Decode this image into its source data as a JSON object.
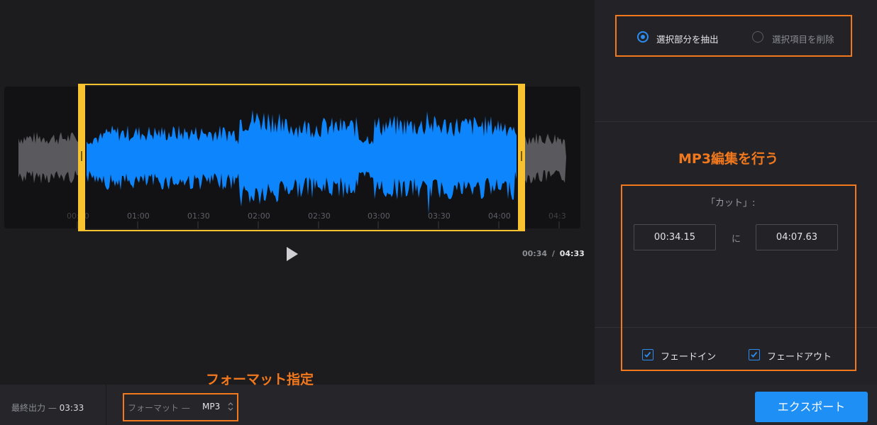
{
  "waveform": {
    "ticks": [
      "00:00",
      "01:00",
      "01:30",
      "02:00",
      "02:30",
      "03:00",
      "03:30",
      "04:00",
      "04:3"
    ]
  },
  "playback": {
    "current": "00:34",
    "separator": "/",
    "total": "04:33"
  },
  "mode": {
    "options": [
      {
        "label": "選択部分を抽出",
        "selected": true
      },
      {
        "label": "選択項目を削除",
        "selected": false
      }
    ]
  },
  "annotations": {
    "edit_heading": "MP3編集を行う",
    "format_heading": "フォーマット指定"
  },
  "cut": {
    "title": "「カット」:",
    "start": "00:34.15",
    "connector": "に",
    "end": "04:07.63"
  },
  "fades": {
    "fade_in": {
      "label": "フェードイン",
      "checked": true
    },
    "fade_out": {
      "label": "フェードアウト",
      "checked": true
    }
  },
  "footer": {
    "final_output_label": "最終出力 —",
    "final_output_value": "03:33",
    "format_label": "フォーマット —",
    "format_value": "MP3",
    "export_label": "エクスポート"
  },
  "colors": {
    "accent": "#1e8ff5",
    "selection": "#f8c230",
    "annotation": "#f2781e",
    "wave_selected": "#0d86fd",
    "wave_unselected": "#5a5a5e"
  }
}
